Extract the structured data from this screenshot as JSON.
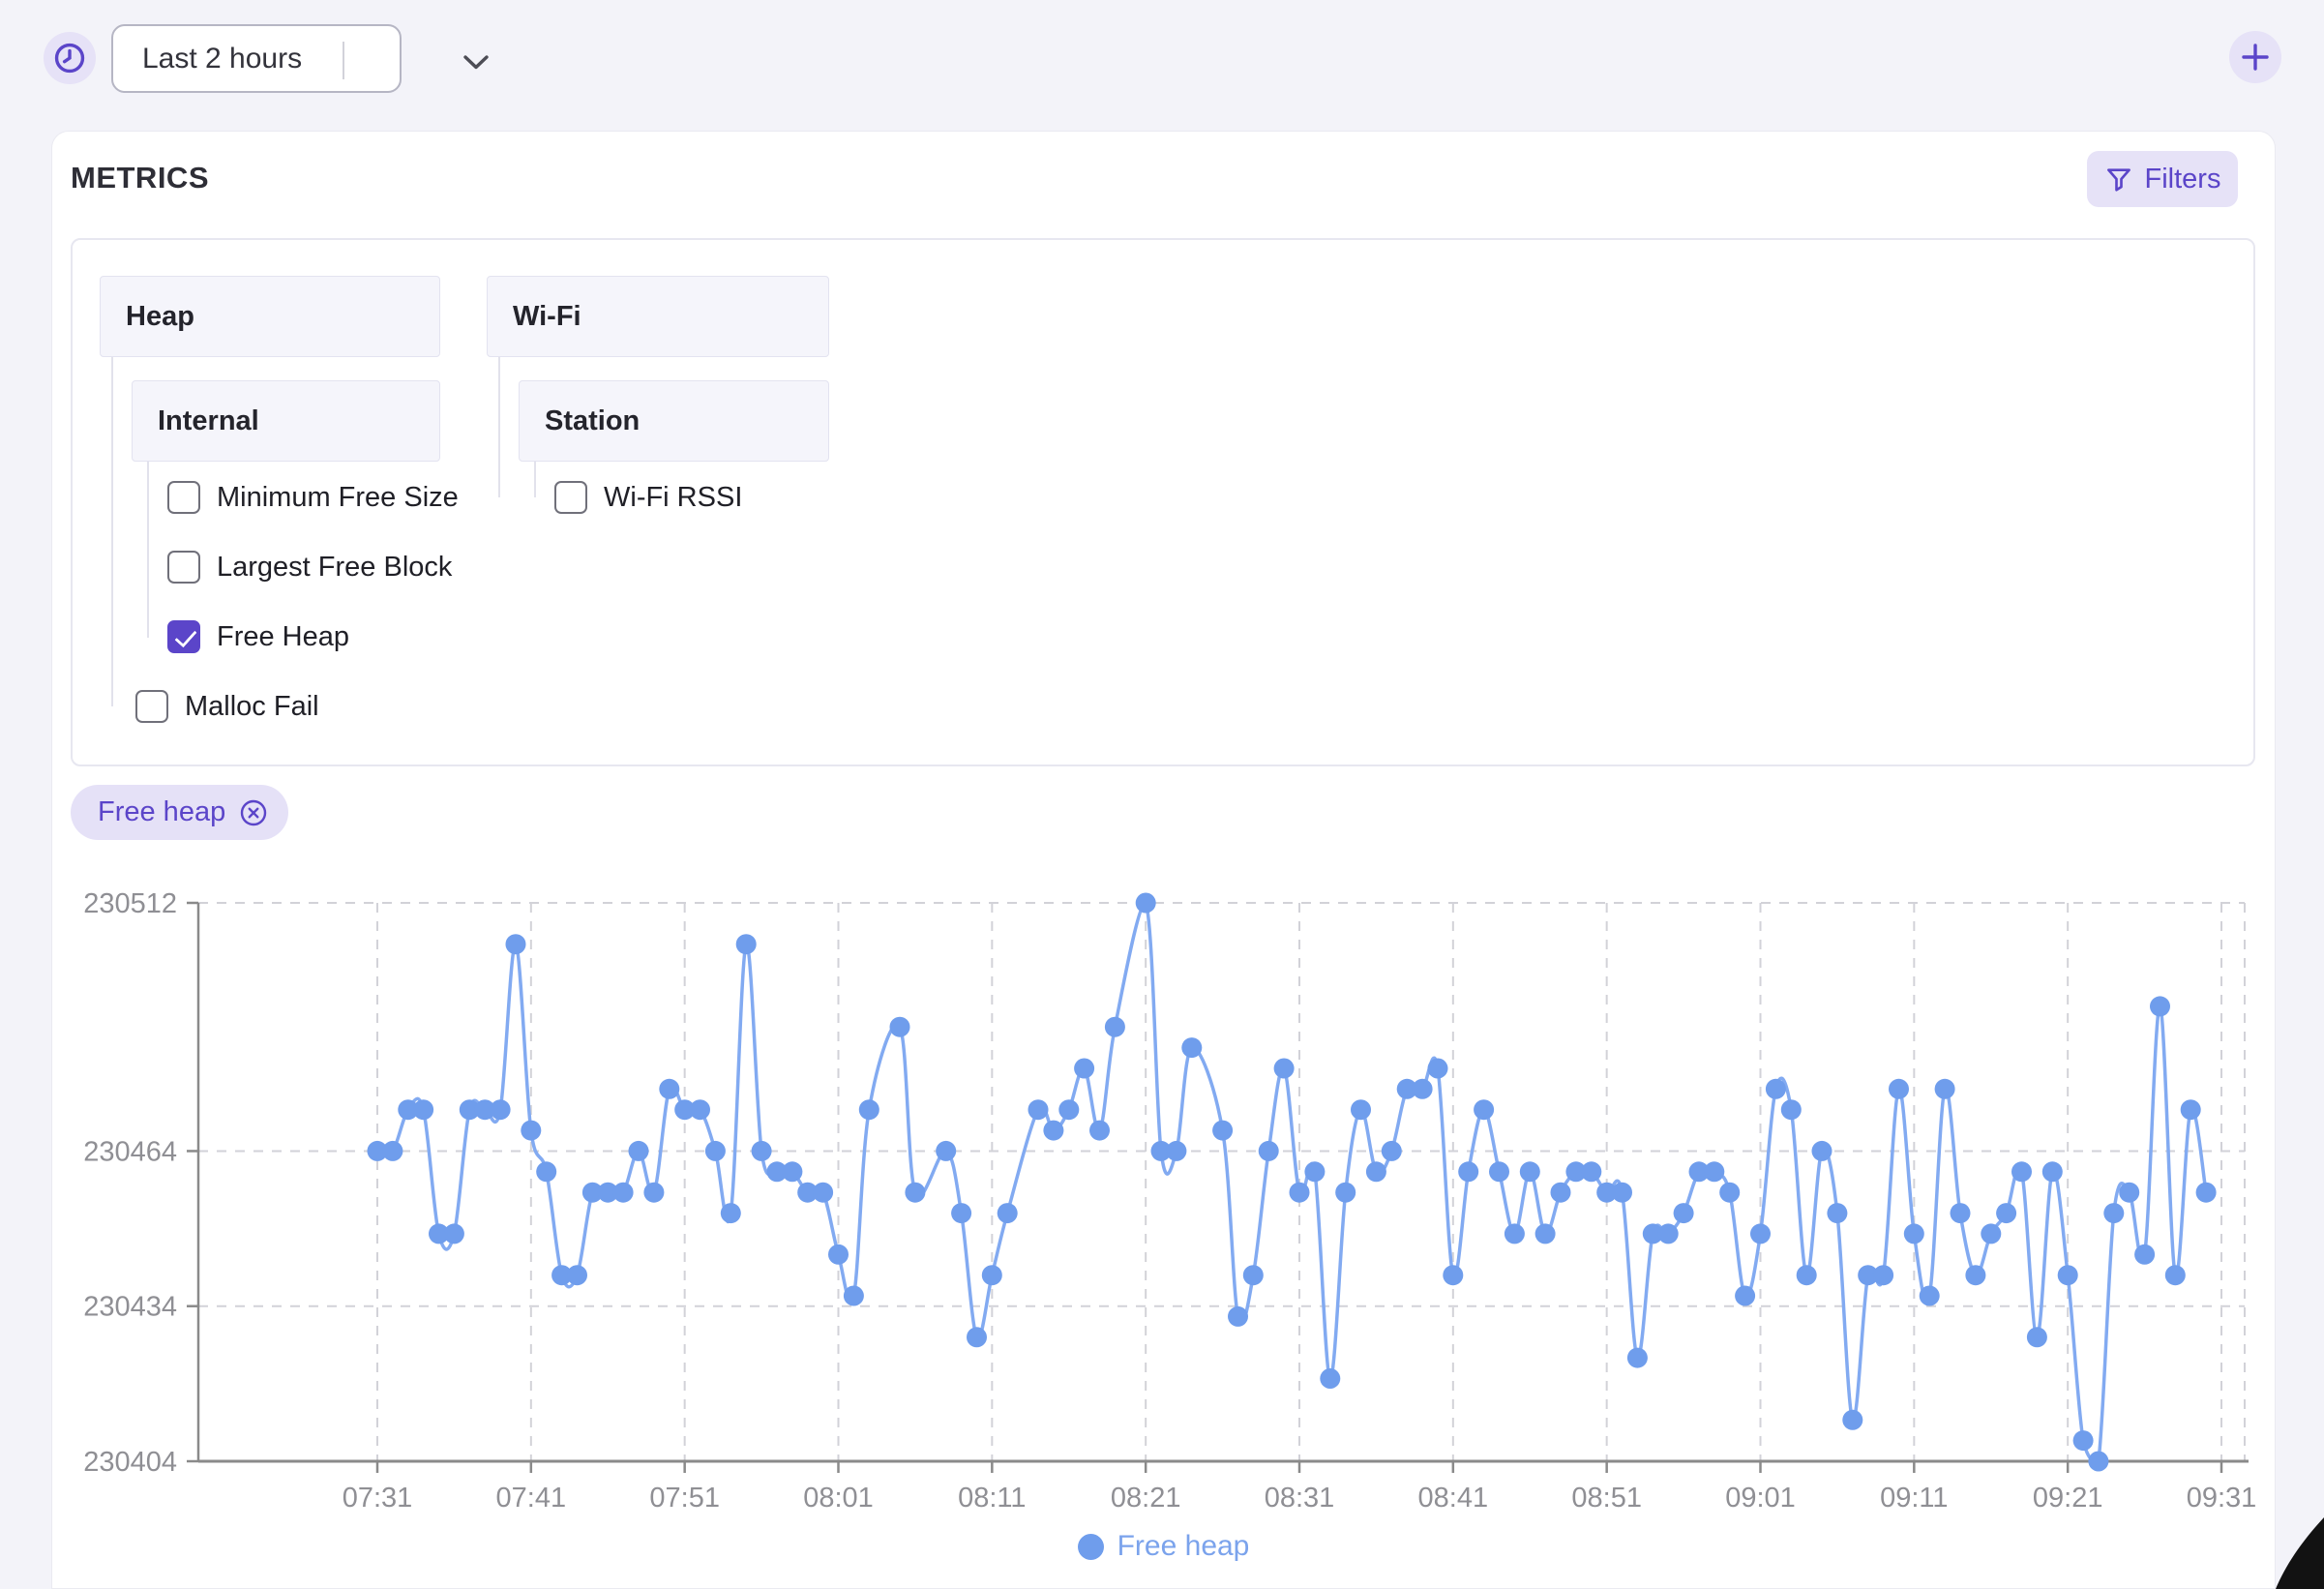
{
  "colors": {
    "accent": "#5b45c9",
    "accent_bg": "#e6e2f7",
    "series_line": "#82aaf1",
    "series_dot": "#6f9dec",
    "legend_text": "#7ba3ec",
    "axis_text": "#8f8f94",
    "grid": "#d2d2d8",
    "axis_line": "#8a8a8a"
  },
  "toolbar": {
    "time_range": {
      "value": "Last 2 hours",
      "icon": "clock"
    },
    "add_button": {
      "icon": "plus"
    }
  },
  "metrics_panel": {
    "title": "METRICS",
    "filters_button": {
      "label": "Filters",
      "icon": "funnel"
    },
    "tree": {
      "groups": [
        {
          "label": "Heap",
          "children": [
            {
              "label": "Internal",
              "children": [
                {
                  "label": "Minimum Free Size",
                  "checked": false
                },
                {
                  "label": "Largest Free Block",
                  "checked": false
                },
                {
                  "label": "Free Heap",
                  "checked": true
                }
              ]
            },
            {
              "label": "Malloc Fail",
              "checked": false
            }
          ]
        },
        {
          "label": "Wi-Fi",
          "children": [
            {
              "label": "Station",
              "children": [
                {
                  "label": "Wi-Fi RSSI",
                  "checked": false
                }
              ]
            }
          ]
        }
      ]
    },
    "selected_chips": [
      {
        "label": "Free heap",
        "icon": "circle-x"
      }
    ]
  },
  "chart_data": {
    "type": "line",
    "title": "",
    "xlabel": "",
    "ylabel": "",
    "ylim": [
      230404,
      230512
    ],
    "y_ticks": [
      230512,
      230464,
      230434,
      230404
    ],
    "x_ticks": [
      "07:31",
      "07:41",
      "07:51",
      "08:01",
      "08:11",
      "08:21",
      "08:31",
      "08:41",
      "08:51",
      "09:01",
      "09:11",
      "09:21",
      "09:31"
    ],
    "grid": "dashed",
    "legend": {
      "position": "bottom"
    },
    "series": [
      {
        "name": "Free heap",
        "color": "#6f9dec",
        "points": [
          [
            "07:31",
            230464
          ],
          [
            "07:32",
            230464
          ],
          [
            "07:33",
            230472
          ],
          [
            "07:34",
            230472
          ],
          [
            "07:35",
            230448
          ],
          [
            "07:36",
            230448
          ],
          [
            "07:37",
            230472
          ],
          [
            "07:38",
            230472
          ],
          [
            "07:39",
            230472
          ],
          [
            "07:40",
            230504
          ],
          [
            "07:41",
            230468
          ],
          [
            "07:42",
            230460
          ],
          [
            "07:43",
            230440
          ],
          [
            "07:44",
            230440
          ],
          [
            "07:45",
            230456
          ],
          [
            "07:46",
            230456
          ],
          [
            "07:47",
            230456
          ],
          [
            "07:48",
            230464
          ],
          [
            "07:49",
            230456
          ],
          [
            "07:50",
            230476
          ],
          [
            "07:51",
            230472
          ],
          [
            "07:52",
            230472
          ],
          [
            "07:53",
            230464
          ],
          [
            "07:54",
            230452
          ],
          [
            "07:55",
            230504
          ],
          [
            "07:56",
            230464
          ],
          [
            "07:57",
            230460
          ],
          [
            "07:58",
            230460
          ],
          [
            "07:59",
            230456
          ],
          [
            "08:00",
            230456
          ],
          [
            "08:01",
            230444
          ],
          [
            "08:02",
            230436
          ],
          [
            "08:03",
            230472
          ],
          [
            "08:05",
            230488
          ],
          [
            "08:06",
            230456
          ],
          [
            "08:08",
            230464
          ],
          [
            "08:09",
            230452
          ],
          [
            "08:10",
            230428
          ],
          [
            "08:11",
            230440
          ],
          [
            "08:12",
            230452
          ],
          [
            "08:14",
            230472
          ],
          [
            "08:15",
            230468
          ],
          [
            "08:16",
            230472
          ],
          [
            "08:17",
            230480
          ],
          [
            "08:18",
            230468
          ],
          [
            "08:19",
            230488
          ],
          [
            "08:21",
            230512
          ],
          [
            "08:22",
            230464
          ],
          [
            "08:23",
            230464
          ],
          [
            "08:24",
            230484
          ],
          [
            "08:26",
            230468
          ],
          [
            "08:27",
            230432
          ],
          [
            "08:28",
            230440
          ],
          [
            "08:29",
            230464
          ],
          [
            "08:30",
            230480
          ],
          [
            "08:31",
            230456
          ],
          [
            "08:32",
            230460
          ],
          [
            "08:33",
            230420
          ],
          [
            "08:34",
            230456
          ],
          [
            "08:35",
            230472
          ],
          [
            "08:36",
            230460
          ],
          [
            "08:37",
            230464
          ],
          [
            "08:38",
            230476
          ],
          [
            "08:39",
            230476
          ],
          [
            "08:40",
            230480
          ],
          [
            "08:41",
            230440
          ],
          [
            "08:42",
            230460
          ],
          [
            "08:43",
            230472
          ],
          [
            "08:44",
            230460
          ],
          [
            "08:45",
            230448
          ],
          [
            "08:46",
            230460
          ],
          [
            "08:47",
            230448
          ],
          [
            "08:48",
            230456
          ],
          [
            "08:49",
            230460
          ],
          [
            "08:50",
            230460
          ],
          [
            "08:51",
            230456
          ],
          [
            "08:52",
            230456
          ],
          [
            "08:53",
            230424
          ],
          [
            "08:54",
            230448
          ],
          [
            "08:55",
            230448
          ],
          [
            "08:56",
            230452
          ],
          [
            "08:57",
            230460
          ],
          [
            "08:58",
            230460
          ],
          [
            "08:59",
            230456
          ],
          [
            "09:00",
            230436
          ],
          [
            "09:01",
            230448
          ],
          [
            "09:02",
            230476
          ],
          [
            "09:03",
            230472
          ],
          [
            "09:04",
            230440
          ],
          [
            "09:05",
            230464
          ],
          [
            "09:06",
            230452
          ],
          [
            "09:07",
            230412
          ],
          [
            "09:08",
            230440
          ],
          [
            "09:09",
            230440
          ],
          [
            "09:10",
            230476
          ],
          [
            "09:11",
            230448
          ],
          [
            "09:12",
            230436
          ],
          [
            "09:13",
            230476
          ],
          [
            "09:14",
            230452
          ],
          [
            "09:15",
            230440
          ],
          [
            "09:16",
            230448
          ],
          [
            "09:17",
            230452
          ],
          [
            "09:18",
            230460
          ],
          [
            "09:19",
            230428
          ],
          [
            "09:20",
            230460
          ],
          [
            "09:21",
            230440
          ],
          [
            "09:22",
            230408
          ],
          [
            "09:23",
            230404
          ],
          [
            "09:24",
            230452
          ],
          [
            "09:25",
            230456
          ],
          [
            "09:26",
            230444
          ],
          [
            "09:27",
            230492
          ],
          [
            "09:28",
            230440
          ],
          [
            "09:29",
            230472
          ],
          [
            "09:30",
            230456
          ]
        ]
      }
    ]
  }
}
